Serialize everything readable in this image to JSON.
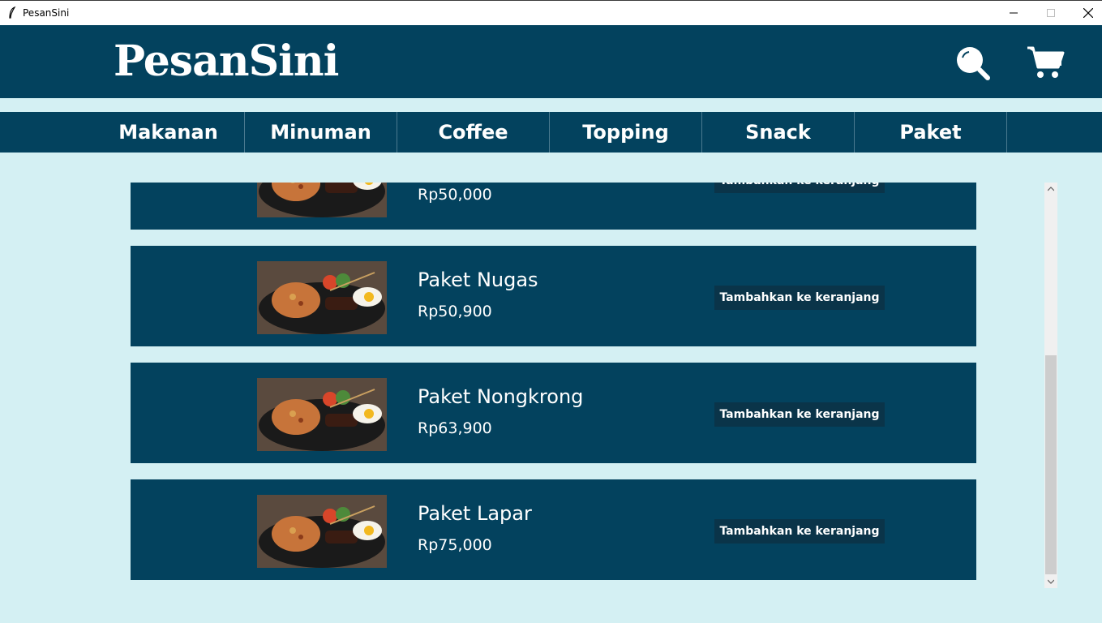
{
  "window": {
    "title": "PesanSini"
  },
  "header": {
    "logo": "PesanSini",
    "icons": [
      "search-icon",
      "cart-icon"
    ]
  },
  "categories": [
    "Makanan",
    "Minuman",
    "Coffee",
    "Topping",
    "Snack",
    "Paket"
  ],
  "products": [
    {
      "name": "",
      "price": "Rp50,000",
      "button": "Tambahkan ke keranjang"
    },
    {
      "name": "Paket Nugas",
      "price": "Rp50,900",
      "button": "Tambahkan ke keranjang"
    },
    {
      "name": "Paket Nongkrong",
      "price": "Rp63,900",
      "button": "Tambahkan ke keranjang"
    },
    {
      "name": "Paket Lapar",
      "price": "Rp75,000",
      "button": "Tambahkan ke keranjang"
    }
  ],
  "colors": {
    "header": "#03425e",
    "background": "#d4f0f3",
    "button": "#0a3449"
  }
}
